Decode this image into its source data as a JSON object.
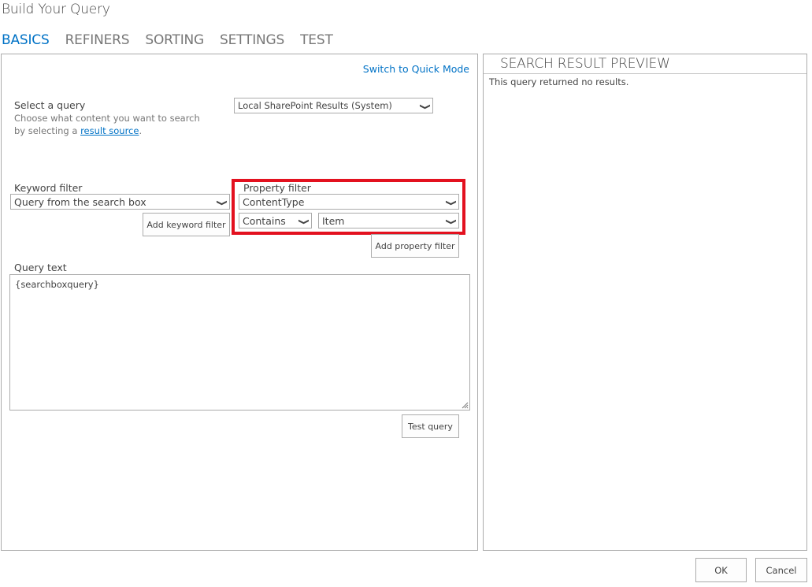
{
  "dialog": {
    "title": "Build Your Query"
  },
  "tabs": [
    {
      "label": "BASICS",
      "active": true
    },
    {
      "label": "REFINERS",
      "active": false
    },
    {
      "label": "SORTING",
      "active": false
    },
    {
      "label": "SETTINGS",
      "active": false
    },
    {
      "label": "TEST",
      "active": false
    }
  ],
  "left": {
    "quick_mode_link": "Switch to Quick Mode",
    "select_query": {
      "label": "Select a query",
      "description_prefix": "Choose what content you want to search by selecting a ",
      "description_link": "result source",
      "description_suffix": ".",
      "selected": "Local SharePoint Results (System)"
    },
    "keyword_filter": {
      "label": "Keyword filter",
      "selected": "Query from the search box",
      "add_button": "Add keyword filter"
    },
    "property_filter": {
      "label": "Property filter",
      "property_selected": "ContentType",
      "operator_selected": "Contains",
      "value_selected": "Item",
      "add_button": "Add property filter"
    },
    "query_text": {
      "label": "Query text",
      "value": "{searchboxquery}"
    },
    "test_query_button": "Test query"
  },
  "preview": {
    "title": "SEARCH RESULT PREVIEW",
    "message": "This query returned no results."
  },
  "footer": {
    "ok_label": "OK",
    "cancel_label": "Cancel"
  },
  "icons": {
    "chevron": "chevron-down-icon"
  },
  "colors": {
    "accent": "#0072c6",
    "highlight": "#e3111f",
    "border": "#ababab",
    "text": "#444444",
    "muted": "#777777"
  }
}
